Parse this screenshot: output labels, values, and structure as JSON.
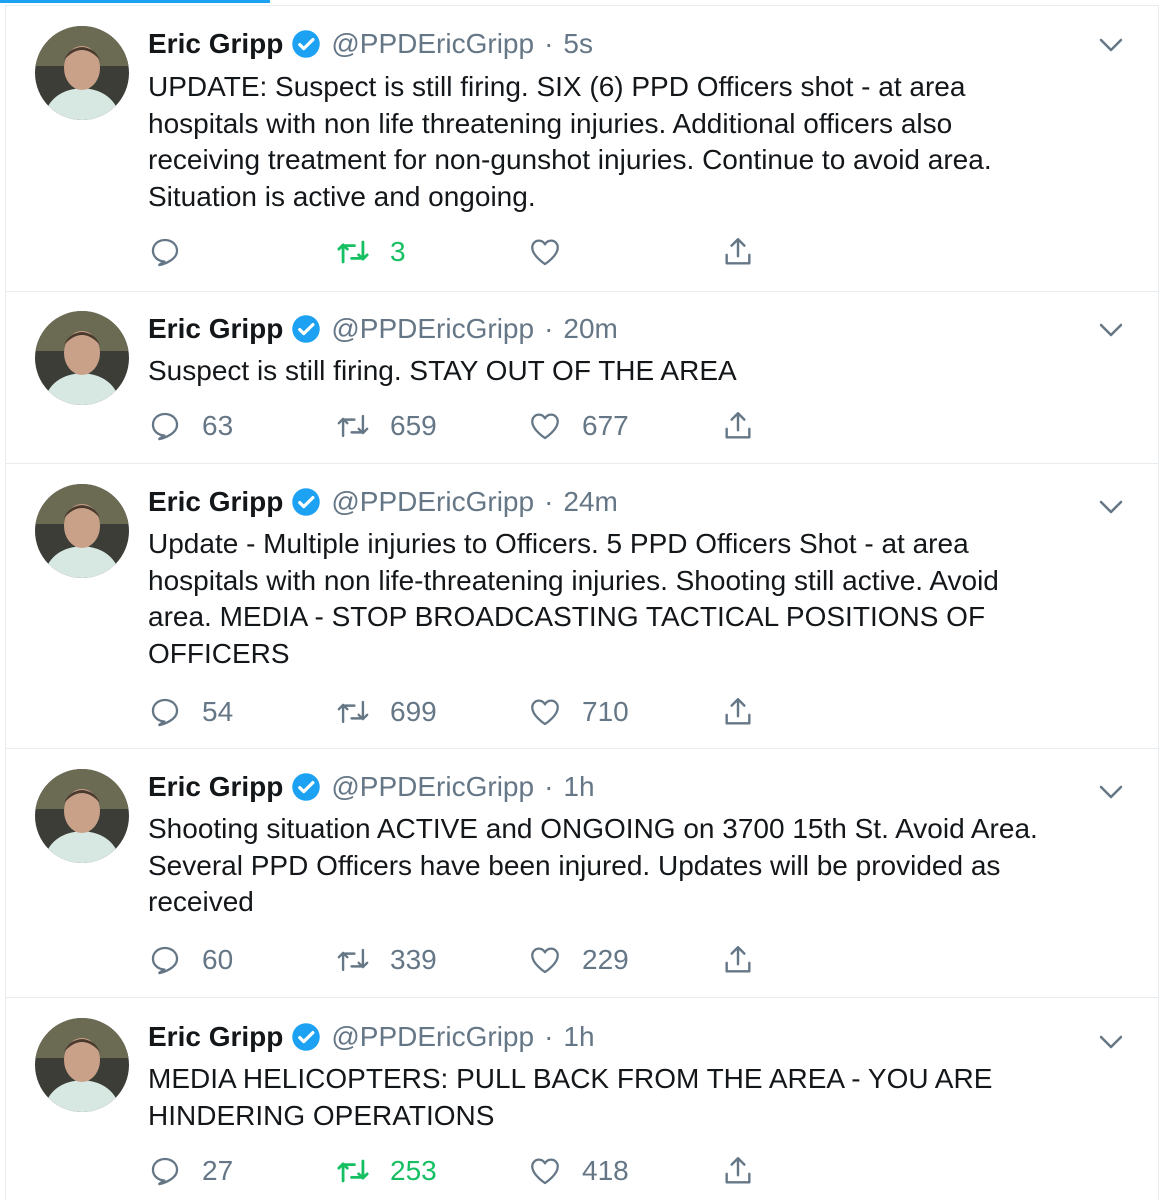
{
  "colors": {
    "accent": "#1da1f2",
    "retweet_active": "#17bf63",
    "secondary_text": "#657786",
    "primary_text": "#14171a",
    "border": "#e6ecf0"
  },
  "tweets": [
    {
      "author_name": "Eric Gripp",
      "handle": "@PPDEricGripp",
      "separator": "·",
      "time": "5s",
      "text_lines": [
        "UPDATE: Suspect is still firing. SIX (6) PPD Officers shot - at area",
        "hospitals with non life threatening injuries. Additional officers also",
        "receiving treatment for non-gunshot injuries. Continue to avoid area.",
        "Situation is active and ongoing."
      ],
      "replies": "",
      "retweets": "3",
      "likes": "",
      "retweeted": true
    },
    {
      "author_name": "Eric Gripp",
      "handle": "@PPDEricGripp",
      "separator": "·",
      "time": "20m",
      "text_lines": [
        "Suspect is still firing. STAY OUT OF THE AREA"
      ],
      "replies": "63",
      "retweets": "659",
      "likes": "677",
      "retweeted": false
    },
    {
      "author_name": "Eric Gripp",
      "handle": "@PPDEricGripp",
      "separator": "·",
      "time": "24m",
      "text_lines": [
        "Update - Multiple injuries to Officers. 5 PPD Officers Shot - at area",
        "hospitals with non life-threatening injuries. Shooting still active. Avoid",
        "area. MEDIA - STOP BROADCASTING TACTICAL POSITIONS OF",
        "OFFICERS"
      ],
      "replies": "54",
      "retweets": "699",
      "likes": "710",
      "retweeted": false
    },
    {
      "author_name": "Eric Gripp",
      "handle": "@PPDEricGripp",
      "separator": "·",
      "time": "1h",
      "text_lines": [
        "Shooting situation ACTIVE and ONGOING on 3700 15th St. Avoid Area.",
        "Several PPD Officers have been injured. Updates will be provided as",
        "received"
      ],
      "replies": "60",
      "retweets": "339",
      "likes": "229",
      "retweeted": false
    },
    {
      "author_name": "Eric Gripp",
      "handle": "@PPDEricGripp",
      "separator": "·",
      "time": "1h",
      "text_lines": [
        "MEDIA HELICOPTERS: PULL BACK FROM THE AREA - YOU ARE",
        "HINDERING OPERATIONS"
      ],
      "replies": "27",
      "retweets": "253",
      "likes": "418",
      "retweeted": true
    }
  ]
}
